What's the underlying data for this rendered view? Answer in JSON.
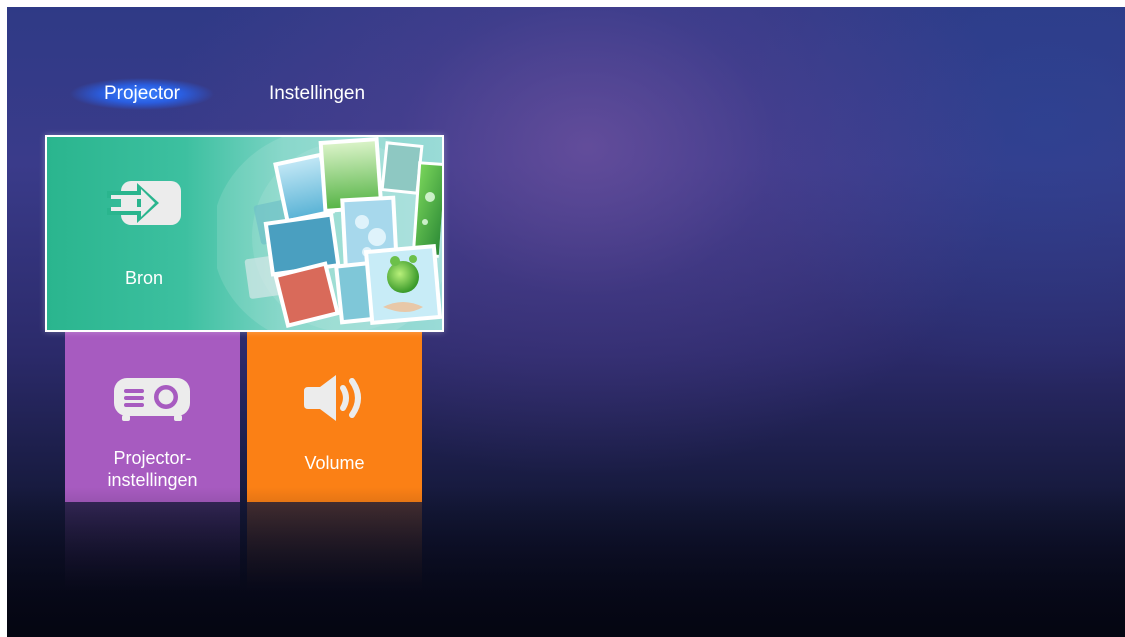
{
  "tabs": [
    {
      "label": "Projector",
      "active": true
    },
    {
      "label": "Instellingen",
      "active": false
    }
  ],
  "tiles": {
    "source": {
      "label": "Bron",
      "icon": "input-source-icon",
      "color": "#2ab58e"
    },
    "projector": {
      "label_line1": "Projector-",
      "label_line2": "instellingen",
      "icon": "projector-icon",
      "color": "#a75bc0"
    },
    "volume": {
      "label": "Volume",
      "icon": "speaker-icon",
      "color": "#fb8015"
    }
  },
  "colors": {
    "tab_active_glow": "#3c82ff",
    "focus_border": "#ffffff"
  }
}
